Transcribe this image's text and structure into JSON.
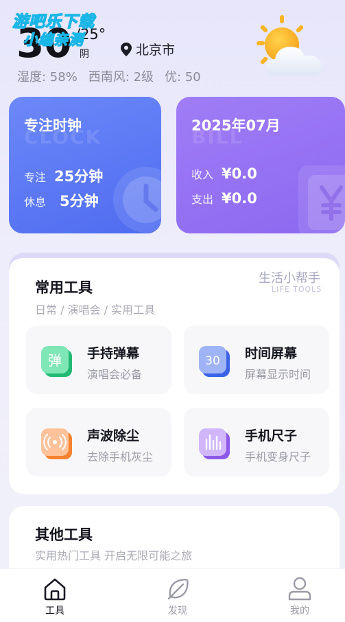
{
  "watermark": {
    "line1": "游吧乐下载",
    "line2": "小编亲测"
  },
  "weather": {
    "temperature": "30",
    "range": "/25°",
    "condition": "阴",
    "city": "北京市",
    "humidity": "湿度: 58%",
    "wind": "西南风: 2级",
    "aqi": "优: 50",
    "icon": "sun-cloud-icon"
  },
  "focus_card": {
    "title": "专注时钟",
    "ghost": "CLOCK",
    "focus_label": "专注",
    "focus_value": "25分钟",
    "rest_label": "休息",
    "rest_value": "5分钟",
    "color": "#5b78f4"
  },
  "month_card": {
    "title": "2025年07月",
    "ghost": "BILL",
    "income_label": "收入",
    "income_value": "¥0.0",
    "expense_label": "支出",
    "expense_value": "¥0.0",
    "color": "#9574f3"
  },
  "common_tools": {
    "title": "常用工具",
    "subtitle": "日常 / 演唱会 / 实用工具",
    "helper": "生活小帮手",
    "helper_en": "LIFE TOOLS",
    "items": [
      {
        "name": "手持弹幕",
        "desc": "演唱会必备",
        "icon": "danmu-icon",
        "glyph": "弹"
      },
      {
        "name": "时间屏幕",
        "desc": "屏幕显示时间",
        "icon": "time-screen-icon",
        "glyph": "30"
      },
      {
        "name": "声波除尘",
        "desc": "去除手机灰尘",
        "icon": "sound-wave-icon"
      },
      {
        "name": "手机尺子",
        "desc": "手机变身尺子",
        "icon": "ruler-icon"
      }
    ]
  },
  "other_tools": {
    "title": "其他工具",
    "subtitle": "实用热门工具 开启无限可能之旅"
  },
  "bottom_nav": [
    {
      "label": "工具",
      "icon": "home-icon",
      "active": true
    },
    {
      "label": "发现",
      "icon": "leaf-icon",
      "active": false
    },
    {
      "label": "我的",
      "icon": "user-icon",
      "active": false
    }
  ]
}
